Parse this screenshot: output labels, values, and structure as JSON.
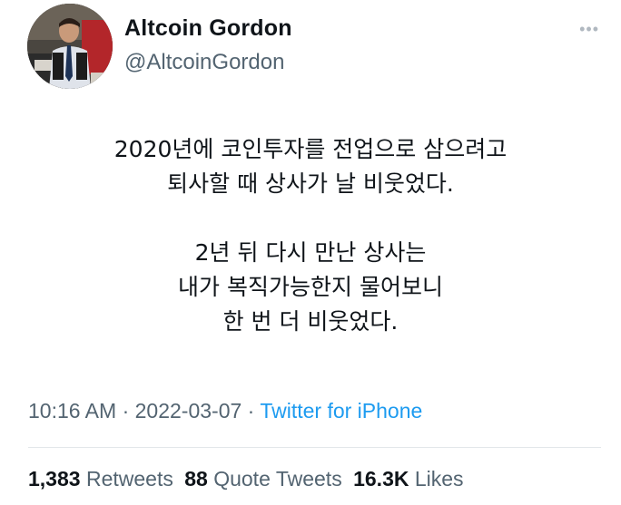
{
  "author": {
    "display_name": "Altcoin Gordon",
    "handle": "@AltcoinGordon"
  },
  "menu": {
    "more_label": "•••"
  },
  "tweet": {
    "paragraph1": [
      "2020년에 코인투자를 전업으로 삼으려고",
      "퇴사할 때 상사가 날 비웃었다."
    ],
    "paragraph2": [
      "2년 뒤 다시 만난 상사는",
      "내가 복직가능한지 물어보니",
      "한 번 더 비웃었다."
    ]
  },
  "meta": {
    "time": "10:16 AM",
    "separator": " · ",
    "date": "2022-03-07",
    "source": "Twitter for iPhone"
  },
  "stats": {
    "retweets_count": "1,383",
    "retweets_label": "Retweets",
    "quotes_count": "88",
    "quotes_label": "Quote Tweets",
    "likes_count": "16.3K",
    "likes_label": "Likes"
  }
}
